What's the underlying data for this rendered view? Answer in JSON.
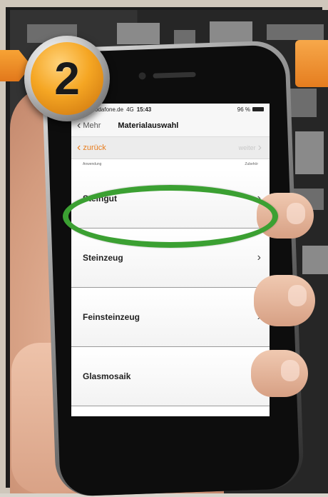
{
  "step": {
    "number": "2"
  },
  "statusbar": {
    "carrier": "Vodafone.de",
    "network": "4G",
    "time": "15:43",
    "battery": "96 %"
  },
  "navbar": {
    "back_label": "Mehr",
    "title": "Materialauswahl"
  },
  "subbar": {
    "back_label": "zurück",
    "next_label": "weiter"
  },
  "hint": {
    "left": "Anwendung",
    "right": "Zubehör"
  },
  "list": {
    "items": [
      {
        "label": "Steingut"
      },
      {
        "label": "Steinzeug"
      },
      {
        "label": "Feinsteinzeug"
      },
      {
        "label": "Glasmosaik"
      }
    ],
    "highlighted_index": 0
  },
  "colors": {
    "accent": "#e87d1e",
    "highlight": "#3ba032",
    "badge": "#f5a623"
  }
}
